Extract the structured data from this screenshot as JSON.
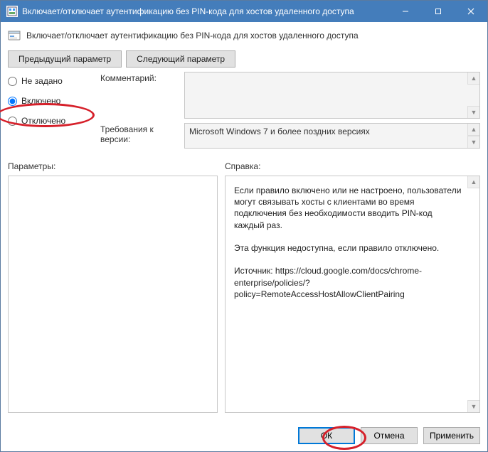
{
  "titlebar": {
    "title": "Включает/отключает аутентификацию без PIN-кода для хостов удаленного доступа"
  },
  "header": {
    "text": "Включает/отключает аутентификацию без PIN-кода для хостов удаленного доступа"
  },
  "nav": {
    "prev": "Предыдущий параметр",
    "next": "Следующий параметр"
  },
  "radios": {
    "not_configured": "Не задано",
    "enabled": "Включено",
    "disabled": "Отключено",
    "selected": "enabled"
  },
  "fields": {
    "comment_label": "Комментарий:",
    "comment_value": "",
    "version_label": "Требования к версии:",
    "version_value": "Microsoft Windows 7 и более поздних версиях"
  },
  "sections": {
    "params_label": "Параметры:",
    "help_label": "Справка:",
    "help_text": "Если правило включено или не настроено, пользователи могут связывать хосты с клиентами во время подключения без необходимости вводить PIN-код каждый раз.\n\nЭта функция недоступна, если правило отключено.\n\nИсточник: https://cloud.google.com/docs/chrome-enterprise/policies/?policy=RemoteAccessHostAllowClientPairing"
  },
  "footer": {
    "ok": "ОК",
    "cancel": "Отмена",
    "apply": "Применить"
  }
}
